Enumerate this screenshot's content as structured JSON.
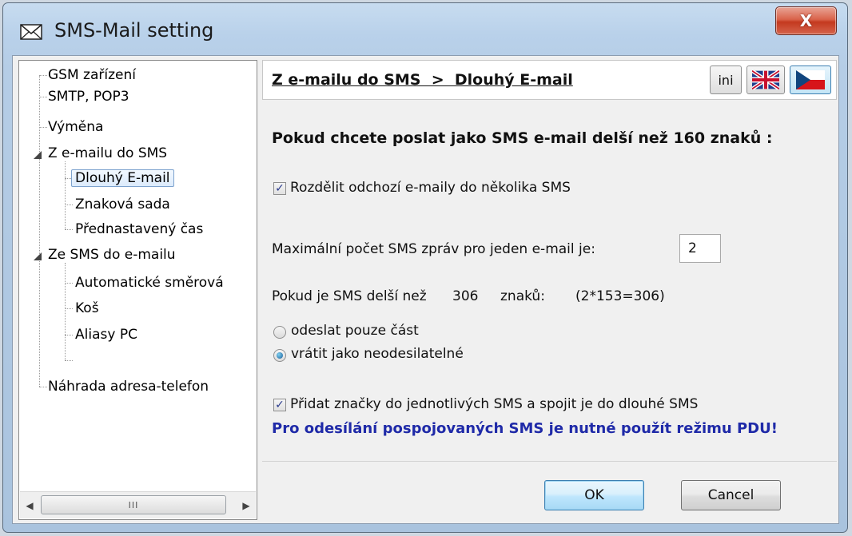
{
  "window": {
    "title": "SMS-Mail setting",
    "close_label": "X"
  },
  "tree": {
    "items": [
      {
        "label": "GSM zařízení"
      },
      {
        "label": "SMTP, POP3"
      },
      {
        "label": "Výměna"
      },
      {
        "label": "Z e-mailu do SMS"
      },
      {
        "label": "Dlouhý E-mail"
      },
      {
        "label": "Znaková sada"
      },
      {
        "label": "Přednastavený čas"
      },
      {
        "label": "Ze SMS do e-mailu"
      },
      {
        "label": "Automatické směrová"
      },
      {
        "label": "Koš"
      },
      {
        "label": "Aliasy PC"
      },
      {
        "label": "Náhrada adresa-telefon"
      }
    ],
    "scroll_thumb_grip": "III"
  },
  "header": {
    "breadcrumb": "Z e-mailu do SMS  >  Dlouhý E-mail",
    "ini_label": "ini"
  },
  "content": {
    "heading": "Pokud chcete poslat jako SMS e-mail delší než 160 znaků :",
    "split_checkbox_label": "Rozdělit odchozí e-maily do několika SMS",
    "split_checked": true,
    "max_label": "Maximální počet SMS zpráv pro jeden e-mail je:",
    "max_value": "2",
    "longer_prefix": "Pokud je SMS delší než",
    "longer_count": "306",
    "longer_suffix": "znaků:",
    "longer_calc": "(2*153=306)",
    "radio_options": [
      "odeslat pouze část",
      "vrátit jako neodesilatelné"
    ],
    "radio_selected_index": 1,
    "concat_checkbox_label": "Přidat značky do jednotlivých SMS a spojit je do dlouhé SMS",
    "concat_checked": true,
    "pdu_note": "Pro odesílání pospojovaných SMS je nutné použít režimu PDU!"
  },
  "footer": {
    "ok_label": "OK",
    "cancel_label": "Cancel"
  }
}
